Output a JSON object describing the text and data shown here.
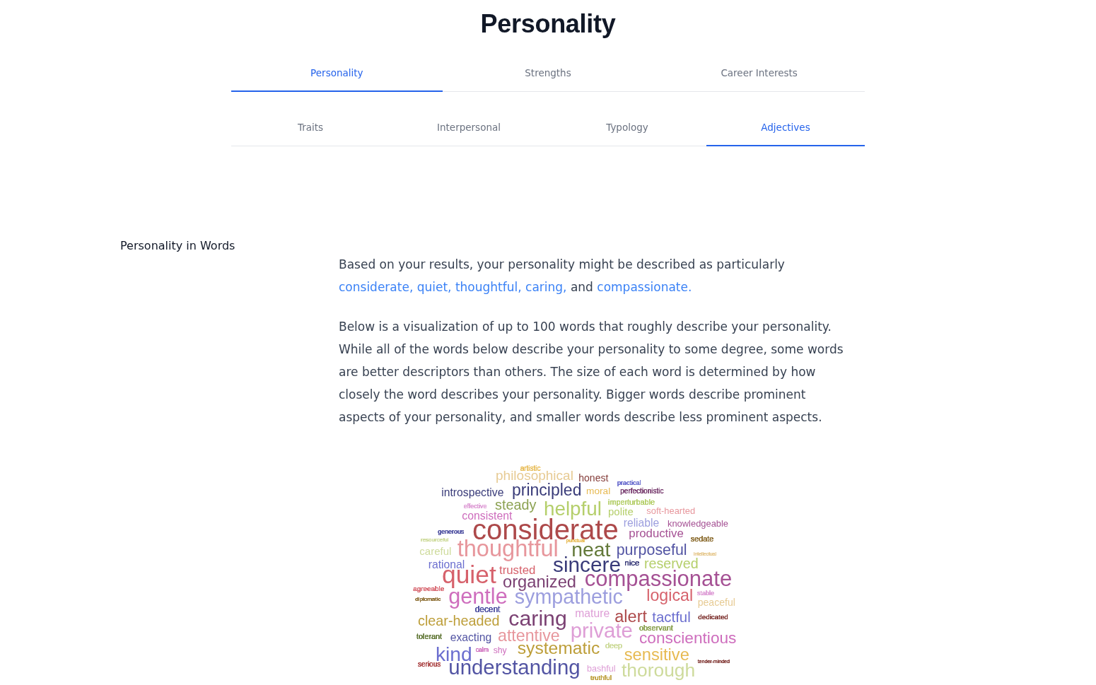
{
  "page_title": "Personality",
  "main_tabs": [
    {
      "label": "Personality",
      "selected": true
    },
    {
      "label": "Strengths",
      "selected": false
    },
    {
      "label": "Career Interests",
      "selected": false
    }
  ],
  "sub_tabs": [
    {
      "label": "Traits",
      "selected": false
    },
    {
      "label": "Interpersonal",
      "selected": false
    },
    {
      "label": "Typology",
      "selected": false
    },
    {
      "label": "Adjectives",
      "selected": true
    }
  ],
  "section": {
    "heading": "Personality in Words",
    "summary": [
      {
        "text": "Based on your results, your personality might be described as particularly",
        "highlighted": false
      },
      {
        "text": "considerate, quiet, thoughtful, caring,",
        "highlighted": true
      },
      {
        "text": "and",
        "highlighted": false
      },
      {
        "text": "compassionate.",
        "highlighted": true
      }
    ],
    "description": "Below is a visualization of up to 100 words that roughly describe your personality. While all of the words below describe your personality to some degree, some words are better descriptors than others. The size of each word is determined by how closely the word describes your personality. Bigger words describe prominent aspects of your personality, and smaller words describe less prominent aspects.",
    "word_cloud": {
      "words": [
        {
          "text": "artistic",
          "color": "#e7ba52"
        },
        {
          "text": "philosophical",
          "color": "#e7cb94"
        },
        {
          "text": "honest",
          "color": "#843c39"
        },
        {
          "text": "practical",
          "color": "#6b6ecf"
        },
        {
          "text": "introspective",
          "color": "#393b79"
        },
        {
          "text": "principled",
          "color": "#393b79"
        },
        {
          "text": "moral",
          "color": "#e7ba52"
        },
        {
          "text": "perfectionistic",
          "color": "#7b4173"
        },
        {
          "text": "effective",
          "color": "#de9ed6"
        },
        {
          "text": "steady",
          "color": "#8ca252"
        },
        {
          "text": "helpful",
          "color": "#b5cf6b"
        },
        {
          "text": "imperturbable",
          "color": "#b5cf6b"
        },
        {
          "text": "polite",
          "color": "#b5cf6b"
        },
        {
          "text": "soft-hearted",
          "color": "#e7969c"
        },
        {
          "text": "consistent",
          "color": "#ce6dbd"
        },
        {
          "text": "reliable",
          "color": "#9c9ede"
        },
        {
          "text": "knowledgeable",
          "color": "#a55194"
        },
        {
          "text": "generous",
          "color": "#5254a3"
        },
        {
          "text": "resourceful",
          "color": "#cedb9c"
        },
        {
          "text": "considerate",
          "color": "#ad494a"
        },
        {
          "text": "punctual",
          "color": "#e7ba52"
        },
        {
          "text": "productive",
          "color": "#a55194"
        },
        {
          "text": "sedate",
          "color": "#8c6d31"
        },
        {
          "text": "careful",
          "color": "#cedb9c"
        },
        {
          "text": "thoughtful",
          "color": "#e7969c"
        },
        {
          "text": "neat",
          "color": "#637939"
        },
        {
          "text": "purposeful",
          "color": "#5254a3"
        },
        {
          "text": "intellectual",
          "color": "#e7cb94"
        },
        {
          "text": "rational",
          "color": "#6b6ecf"
        },
        {
          "text": "trusted",
          "color": "#d6616b"
        },
        {
          "text": "sincere",
          "color": "#393b79"
        },
        {
          "text": "nice",
          "color": "#393b79"
        },
        {
          "text": "reserved",
          "color": "#b5cf6b"
        },
        {
          "text": "agreeable",
          "color": "#d6616b"
        },
        {
          "text": "quiet",
          "color": "#d6616b"
        },
        {
          "text": "organized",
          "color": "#7b4173"
        },
        {
          "text": "compassionate",
          "color": "#a55194"
        },
        {
          "text": "stable",
          "color": "#de9ed6"
        },
        {
          "text": "diplomatic",
          "color": "#8c6d31"
        },
        {
          "text": "gentle",
          "color": "#ce6dbd"
        },
        {
          "text": "sympathetic",
          "color": "#9c9ede"
        },
        {
          "text": "logical",
          "color": "#d6616b"
        },
        {
          "text": "peaceful",
          "color": "#e7cb94"
        },
        {
          "text": "decent",
          "color": "#5254a3"
        },
        {
          "text": "clear-headed",
          "color": "#bd9e39"
        },
        {
          "text": "caring",
          "color": "#7b4173"
        },
        {
          "text": "mature",
          "color": "#de9ed6"
        },
        {
          "text": "alert",
          "color": "#ad494a"
        },
        {
          "text": "tactful",
          "color": "#6b6ecf"
        },
        {
          "text": "dedicated",
          "color": "#843c39"
        },
        {
          "text": "tolerant",
          "color": "#637939"
        },
        {
          "text": "exacting",
          "color": "#5254a3"
        },
        {
          "text": "attentive",
          "color": "#e7969c"
        },
        {
          "text": "private",
          "color": "#de9ed6"
        },
        {
          "text": "observant",
          "color": "#8ca252"
        },
        {
          "text": "deep",
          "color": "#cedb9c"
        },
        {
          "text": "conscientious",
          "color": "#ce6dbd"
        },
        {
          "text": "serious",
          "color": "#ad494a"
        },
        {
          "text": "kind",
          "color": "#6b6ecf"
        },
        {
          "text": "calm",
          "color": "#ce6dbd"
        },
        {
          "text": "shy",
          "color": "#ce6dbd"
        },
        {
          "text": "systematic",
          "color": "#bd9e39"
        },
        {
          "text": "sensitive",
          "color": "#e7ba52"
        },
        {
          "text": "understanding",
          "color": "#5254a3"
        },
        {
          "text": "bashful",
          "color": "#de9ed6"
        },
        {
          "text": "truthful",
          "color": "#bd9e39"
        },
        {
          "text": "thorough",
          "color": "#cedb9c"
        },
        {
          "text": "tender-minded",
          "color": "#843c39"
        }
      ]
    }
  }
}
